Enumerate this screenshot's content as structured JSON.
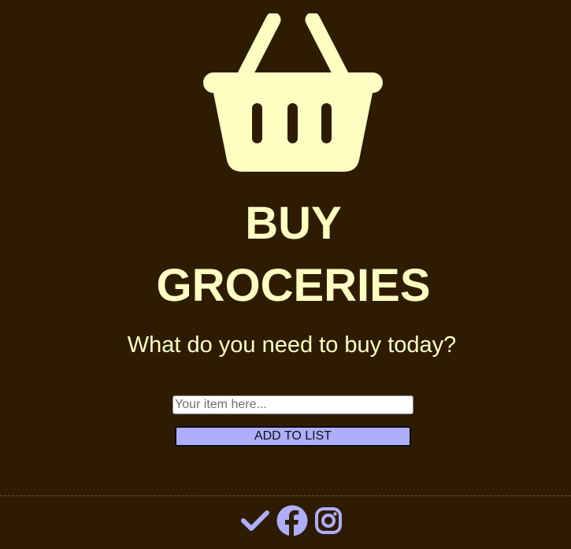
{
  "header": {
    "icon": "basket-icon",
    "title_line1": "BUY",
    "title_line2": "GROCERIES",
    "subtitle": "What do you need to buy today?"
  },
  "form": {
    "input_placeholder": "Your item here...",
    "input_value": "",
    "add_button_label": "ADD TO LIST"
  },
  "footer": {
    "icons": [
      "check-icon",
      "facebook-icon",
      "instagram-icon"
    ]
  },
  "colors": {
    "background": "#2e1c02",
    "accent_text": "#ffffc2",
    "button_and_icons": "#aeaefb"
  }
}
